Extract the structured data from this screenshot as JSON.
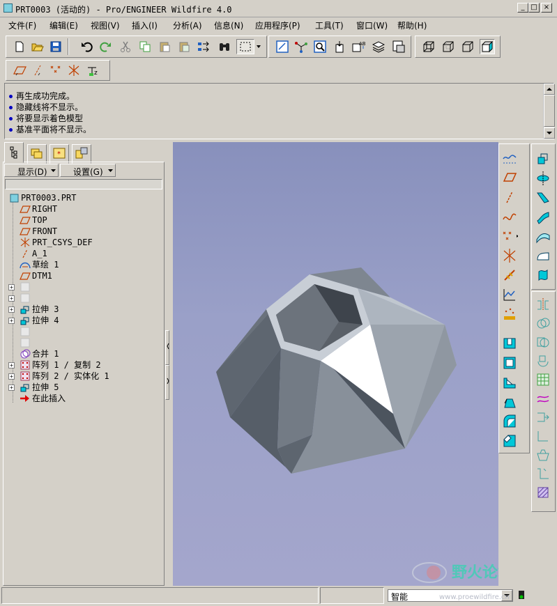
{
  "window": {
    "title": "PRT0003 (活动的) - Pro/ENGINEER Wildfire 4.0",
    "minimize": "_",
    "maximize": "□",
    "close": "×"
  },
  "menu": [
    "文件(F)",
    "编辑(E)",
    "视图(V)",
    "插入(I)",
    "分析(A)",
    "信息(N)",
    "应用程序(P)",
    "工具(T)",
    "窗口(W)",
    "帮助(H)"
  ],
  "messages": [
    "再生成功完成。",
    "隐藏线将不显示。",
    "将要显示着色模型",
    "基准平面将不显示。"
  ],
  "panel": {
    "show_label": "显示(D)",
    "settings_label": "设置(G)",
    "filter_value": ""
  },
  "tree": [
    {
      "label": "PRT0003.PRT",
      "icon": "part-icon",
      "expand": false
    },
    {
      "label": "RIGHT",
      "icon": "datum-plane-icon",
      "expand": false
    },
    {
      "label": "TOP",
      "icon": "datum-plane-icon",
      "expand": false
    },
    {
      "label": "FRONT",
      "icon": "datum-plane-icon",
      "expand": false
    },
    {
      "label": "PRT_CSYS_DEF",
      "icon": "csys-icon",
      "expand": false
    },
    {
      "label": "A_1",
      "icon": "axis-icon",
      "expand": false
    },
    {
      "label": "草绘 1",
      "icon": "sketch-icon",
      "expand": false
    },
    {
      "label": "DTM1",
      "icon": "datum-plane-icon",
      "expand": false
    },
    {
      "label": "",
      "icon": "suppressed-feature-icon",
      "expand": true
    },
    {
      "label": "",
      "icon": "suppressed-feature-icon",
      "expand": true
    },
    {
      "label": "拉伸 3",
      "icon": "extrude-icon",
      "expand": true
    },
    {
      "label": "拉伸 4",
      "icon": "extrude-icon",
      "expand": true
    },
    {
      "label": "",
      "icon": "suppressed-feature-icon",
      "expand": false
    },
    {
      "label": "",
      "icon": "suppressed-feature-icon",
      "expand": false
    },
    {
      "label": "合并 1",
      "icon": "merge-icon",
      "expand": false
    },
    {
      "label": "阵列 1 / 复制 2",
      "icon": "pattern-icon",
      "expand": true
    },
    {
      "label": "阵列 2 / 实体化 1",
      "icon": "pattern-icon",
      "expand": true
    },
    {
      "label": "拉伸 5",
      "icon": "extrude-icon",
      "expand": true
    },
    {
      "label": "在此插入",
      "icon": "insert-here-arrow-icon",
      "expand": false
    }
  ],
  "status": {
    "filter_value": "智能"
  },
  "watermark": {
    "text": "野火论坛",
    "url": "www.proewildfire.cn"
  }
}
